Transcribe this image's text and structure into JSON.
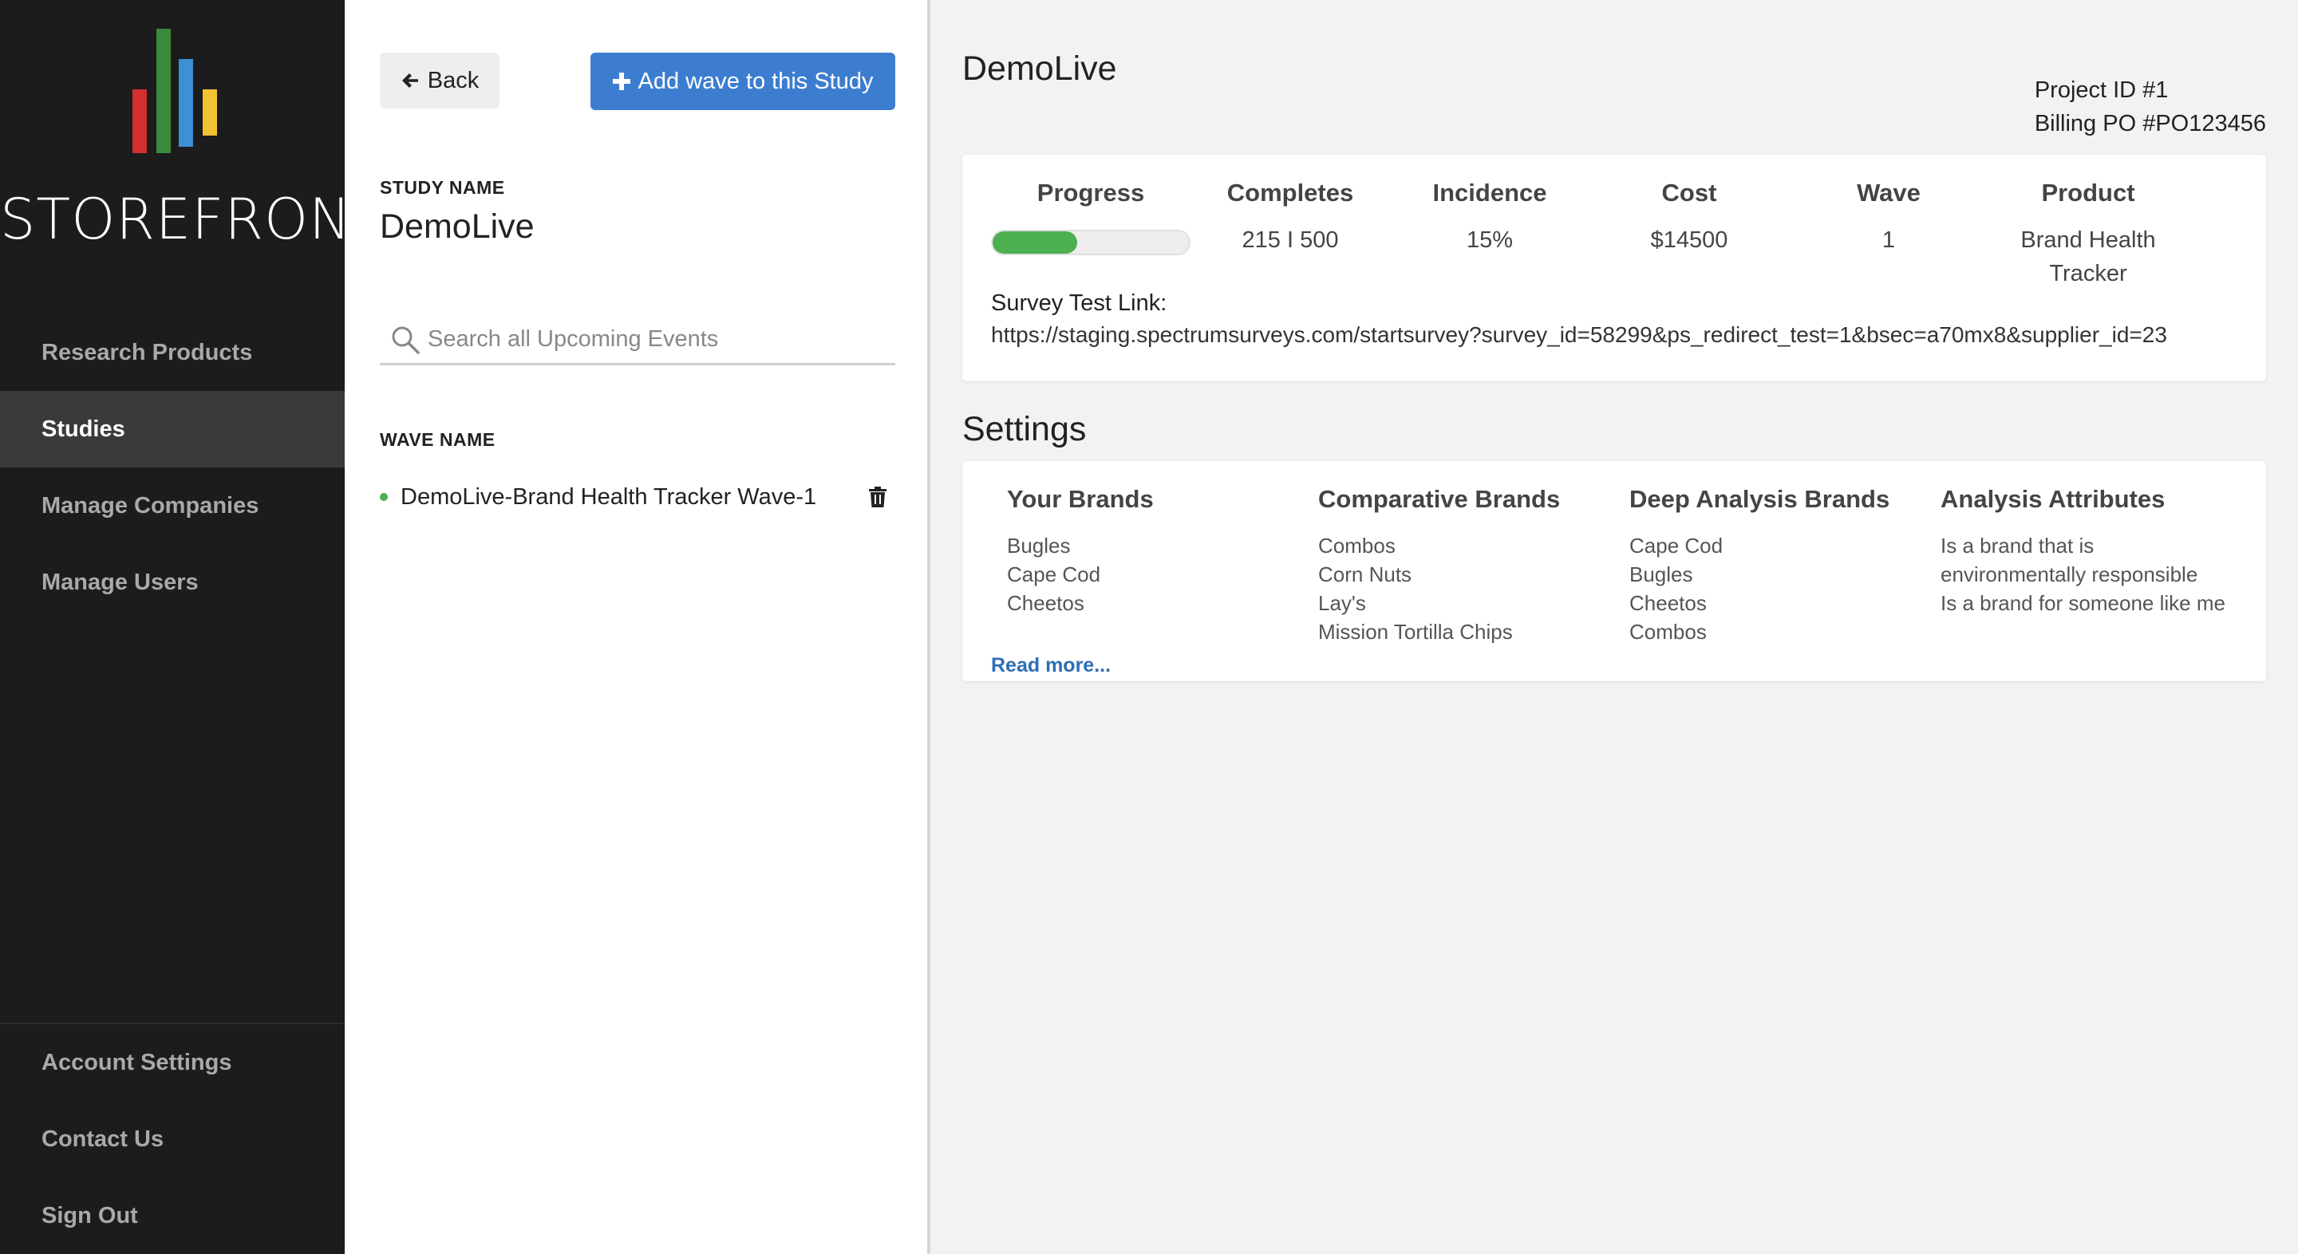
{
  "brand": {
    "name": "STOREFRONT",
    "bar_colors": [
      "#d32f2f",
      "#3a8a3e",
      "#3d8fd6",
      "#f1c232"
    ]
  },
  "sidebar": {
    "items": [
      {
        "label": "Research Products",
        "active": false
      },
      {
        "label": "Studies",
        "active": true
      },
      {
        "label": "Manage Companies",
        "active": false
      },
      {
        "label": "Manage Users",
        "active": false
      }
    ],
    "bottom_items": [
      {
        "label": "Account Settings"
      },
      {
        "label": "Contact Us"
      },
      {
        "label": "Sign Out"
      }
    ]
  },
  "middle": {
    "back_label": "Back",
    "add_wave_label": "Add wave to this Study",
    "study_name_label": "STUDY NAME",
    "study_name": "DemoLive",
    "search_placeholder": "Search all Upcoming Events",
    "wave_name_label": "WAVE NAME",
    "waves": [
      {
        "name": "DemoLive-Brand Health Tracker Wave-1"
      }
    ]
  },
  "main": {
    "title": "DemoLive",
    "project_id": "Project ID #1",
    "billing_po": "Billing PO #PO123456",
    "stats": {
      "progress_label": "Progress",
      "progress_fraction": 0.43,
      "completes_label": "Completes",
      "completes": "215 I 500",
      "incidence_label": "Incidence",
      "incidence": "15%",
      "cost_label": "Cost",
      "cost": "$14500",
      "wave_label": "Wave",
      "wave": "1",
      "product_label": "Product",
      "product": "Brand Health Tracker"
    },
    "survey_label": "Survey Test Link:",
    "survey_link": "https://staging.spectrumsurveys.com/startsurvey?survey_id=58299&ps_redirect_test=1&bsec=a70mx8&supplier_id=23",
    "settings_title": "Settings",
    "settings": {
      "columns": [
        {
          "title": "Your Brands",
          "items": [
            "Bugles",
            "Cape Cod",
            "Cheetos"
          ]
        },
        {
          "title": "Comparative Brands",
          "items": [
            "Combos",
            "Corn Nuts",
            "Lay's",
            "Mission Tortilla Chips"
          ]
        },
        {
          "title": "Deep Analysis Brands",
          "items": [
            "Cape Cod",
            "Bugles",
            "Cheetos",
            "Combos"
          ]
        },
        {
          "title": "Analysis Attributes",
          "items": [
            "Is a brand that is environmentally responsible",
            "Is a brand for someone like me"
          ]
        }
      ],
      "read_more": "Read more..."
    }
  }
}
